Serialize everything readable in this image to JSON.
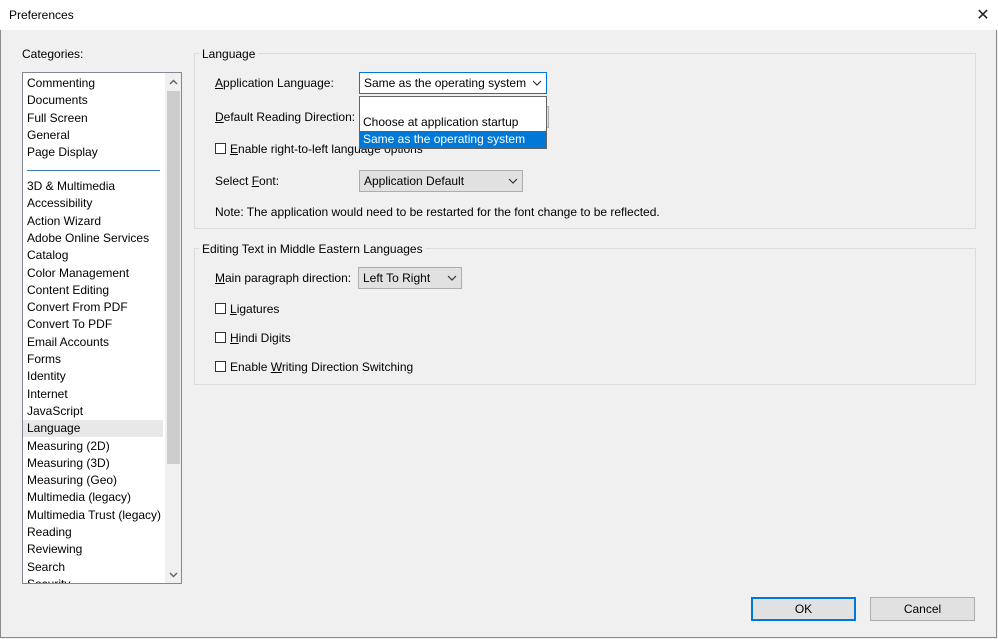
{
  "window": {
    "title": "Preferences",
    "close_glyph": "✕"
  },
  "categories": {
    "label": "Categories:",
    "items_top": [
      "Commenting",
      "Documents",
      "Full Screen",
      "General",
      "Page Display"
    ],
    "items_bottom": [
      "3D & Multimedia",
      "Accessibility",
      "Action Wizard",
      "Adobe Online Services",
      "Catalog",
      "Color Management",
      "Content Editing",
      "Convert From PDF",
      "Convert To PDF",
      "Email Accounts",
      "Forms",
      "Identity",
      "Internet",
      "JavaScript",
      "Language",
      "Measuring (2D)",
      "Measuring (3D)",
      "Measuring (Geo)",
      "Multimedia (legacy)",
      "Multimedia Trust (legacy)",
      "Reading",
      "Reviewing",
      "Search",
      "Security"
    ],
    "selected": "Language"
  },
  "language_group": {
    "title": "Language",
    "app_language_label": "Application Language:",
    "app_language_value": "Same as the operating system",
    "reading_direction_label": "Default Reading Direction:",
    "rtl_checkbox_label": "Enable right-to-left language options",
    "select_font_label": "Select Font:",
    "select_font_value": "Application Default",
    "note": "Note: The application would need to be restarted for the font change to be reflected."
  },
  "dropdown": {
    "options": [
      "Choose at application startup",
      "Same as the operating system"
    ],
    "highlighted_index": 1
  },
  "middle_eastern_group": {
    "title": "Editing Text in Middle Eastern Languages",
    "paragraph_direction_label": "Main paragraph direction:",
    "paragraph_direction_value": "Left To Right",
    "ligatures_label": "Ligatures",
    "hindi_digits_label": "Hindi Digits",
    "writing_direction_label": "Enable Writing Direction Switching"
  },
  "buttons": {
    "ok": "OK",
    "cancel": "Cancel"
  },
  "colors": {
    "accent": "#0078d7",
    "list_separator": "#3c7fb1",
    "selected_row": "#e8e8e8"
  }
}
